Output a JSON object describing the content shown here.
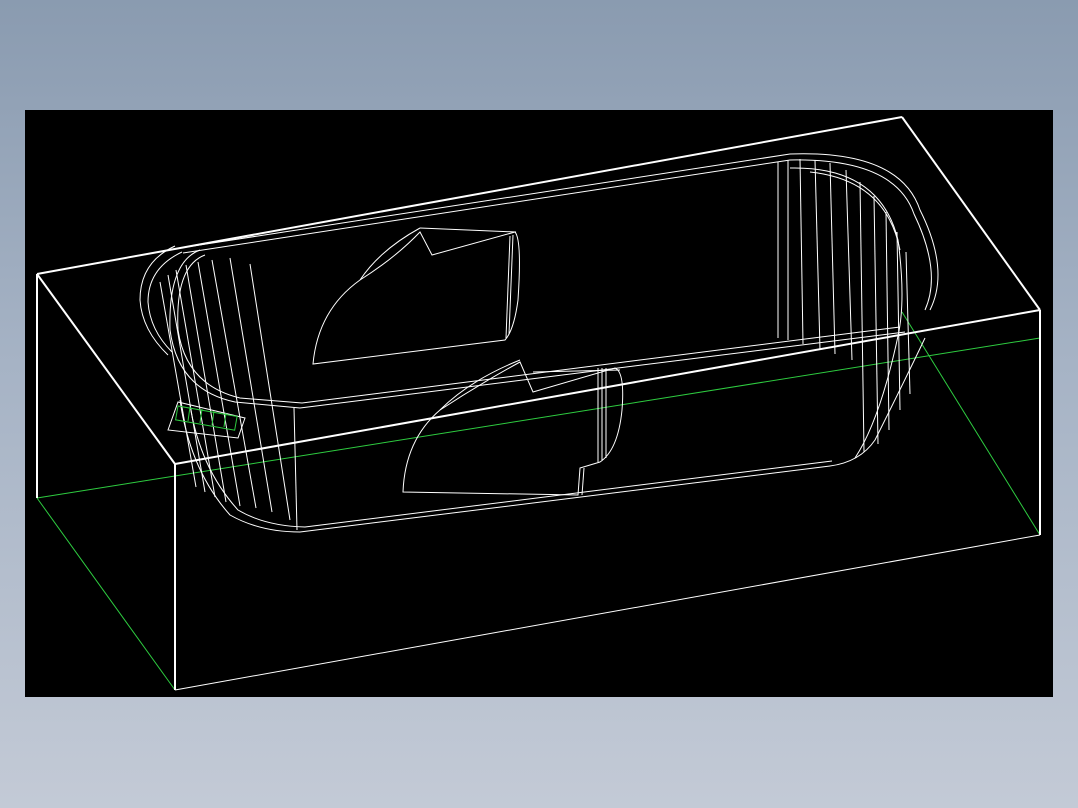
{
  "drawing": {
    "subject": "bathtub-wireframe",
    "background_color": "#000000",
    "line_color": "#ffffff",
    "accent_color": "#2ecc40",
    "page_background_top": "#8a9bb0",
    "page_background_bottom": "#c3cad6"
  }
}
